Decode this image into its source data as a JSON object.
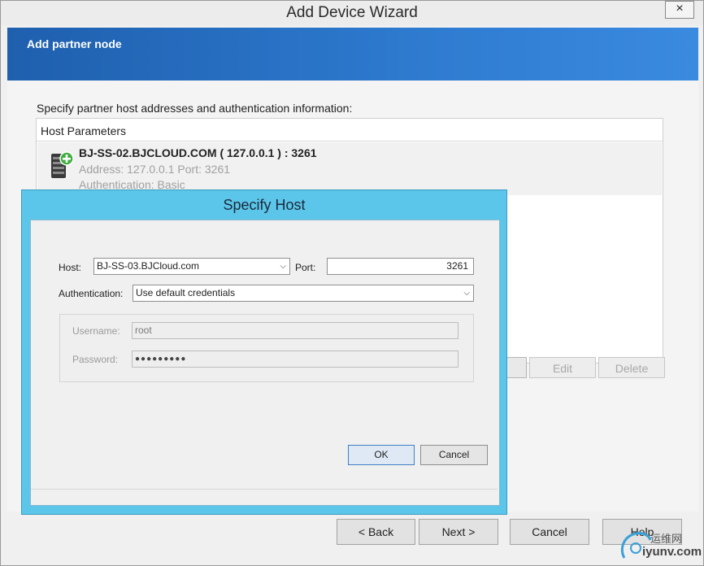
{
  "wizard": {
    "title": "Add Device Wizard",
    "close_glyph": "×",
    "banner_title": "Add partner node",
    "instruction": "Specify partner host addresses and authentication information:",
    "panel_header": "Host Parameters",
    "host_entry": {
      "name": "BJ-SS-02.BJCLOUD.COM ( 127.0.0.1 ) : 3261",
      "address_line": "Address: 127.0.0.1 Port: 3261",
      "auth_line": "Authentication: Basic",
      "icon": "server-add-icon"
    },
    "list_buttons": {
      "edit": "Edit",
      "delete": "Delete"
    },
    "footer": {
      "back": "< Back",
      "next": "Next >",
      "cancel": "Cancel",
      "help": "Help"
    }
  },
  "dialog": {
    "title": "Specify Host",
    "host_label": "Host:",
    "host_value": "BJ-SS-03.BJCloud.com",
    "port_label": "Port:",
    "port_value": "3261",
    "auth_label": "Authentication:",
    "auth_value": "Use default credentials",
    "username_label": "Username:",
    "username_value": "root",
    "password_label": "Password:",
    "password_value": "●●●●●●●●●",
    "ok": "OK",
    "cancel": "Cancel"
  },
  "watermark": {
    "line1": "运维网",
    "line2": "iyunv.com"
  },
  "colors": {
    "banner": "#1f5fae",
    "dialog_frame": "#5cc6ea",
    "default_button_border": "#3d7fc5"
  }
}
